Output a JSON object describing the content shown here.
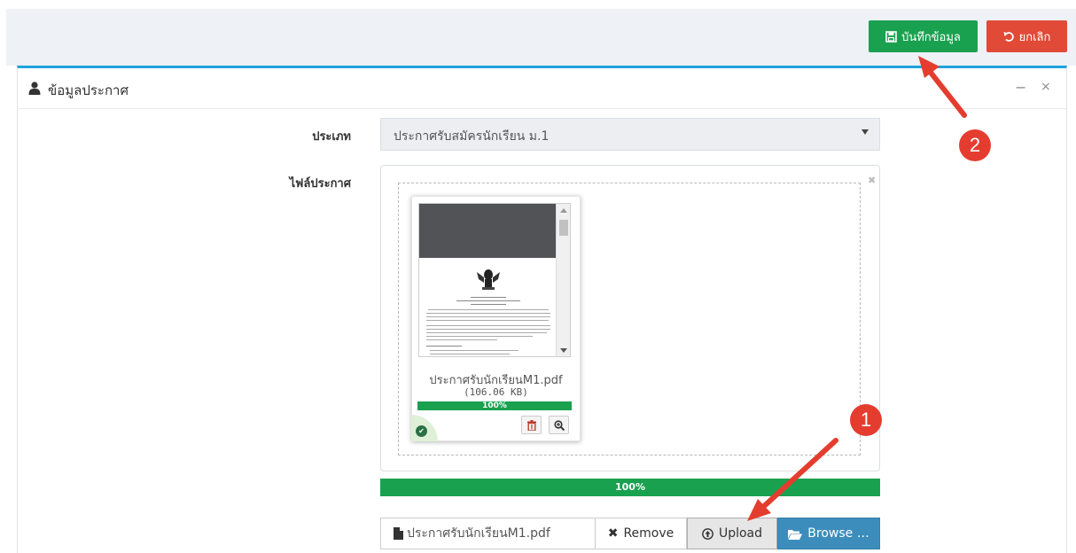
{
  "toolbar": {
    "save_label": "บันทึกข้อมูล",
    "cancel_label": "ยกเลิก",
    "save_icon": "floppy-disk-icon",
    "cancel_icon": "undo-icon",
    "colors": {
      "save": "#1aa150",
      "cancel": "#e04a37"
    }
  },
  "panel": {
    "title": "ข้อมูลประกาศ",
    "title_icon": "user-icon",
    "collapse_label": "−",
    "close_label": "×",
    "accent": "#1ea3dc"
  },
  "form": {
    "type_label": "ประเภท",
    "type_value": "ประกาศรับสมัครนักเรียน ม.1",
    "file_label": "ไฟล์ประกาศ"
  },
  "preview": {
    "file_name": "ประกาศรับนักเรียนM1.pdf",
    "file_size": "(106.06 KB)",
    "progress_label": "100%",
    "progress": 1.0,
    "delete_icon": "trash-icon",
    "zoom_icon": "zoom-in-icon",
    "status_icon": "check-circle-icon"
  },
  "upload": {
    "progress_label": "100%",
    "progress": 1.0,
    "caption": "ประกาศรับนักเรียนM1.pdf",
    "remove_label": "Remove",
    "upload_label": "Upload",
    "browse_label": "Browse …"
  },
  "annotations": [
    {
      "number": "1"
    },
    {
      "number": "2"
    }
  ]
}
